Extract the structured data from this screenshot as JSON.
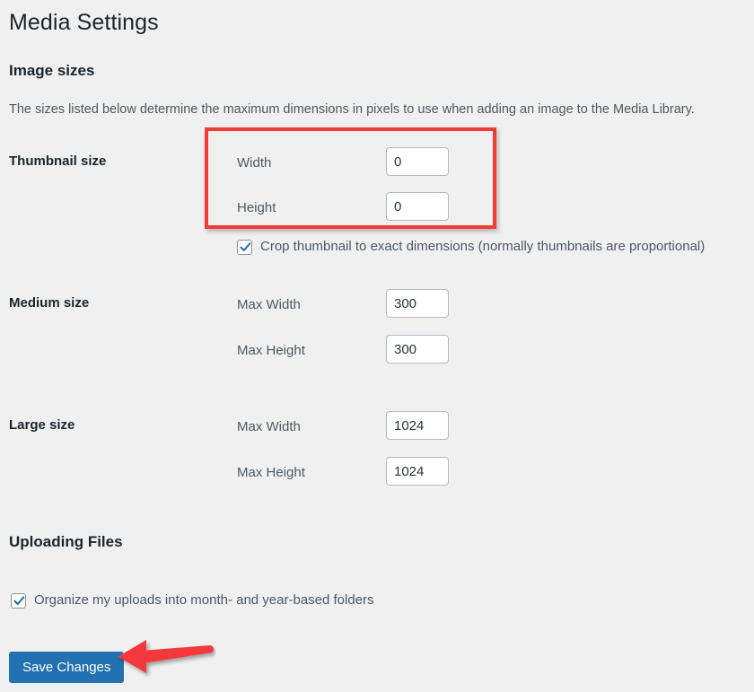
{
  "page": {
    "title": "Media Settings",
    "background_color": "#f0f0f1"
  },
  "image_sizes": {
    "heading": "Image sizes",
    "description": "The sizes listed below determine the maximum dimensions in pixels to use when adding an image to the Media Library.",
    "thumbnail": {
      "row_label": "Thumbnail size",
      "width_label": "Width",
      "width_value": "0",
      "height_label": "Height",
      "height_value": "0",
      "crop_checkbox": {
        "label": "Crop thumbnail to exact dimensions (normally thumbnails are proportional)",
        "checked": true
      }
    },
    "medium": {
      "row_label": "Medium size",
      "width_label": "Max Width",
      "width_value": "300",
      "height_label": "Max Height",
      "height_value": "300"
    },
    "large": {
      "row_label": "Large size",
      "width_label": "Max Width",
      "width_value": "1024",
      "height_label": "Max Height",
      "height_value": "1024"
    }
  },
  "uploading_files": {
    "heading": "Uploading Files",
    "organize_checkbox": {
      "label": "Organize my uploads into month- and year-based folders",
      "checked": true
    }
  },
  "actions": {
    "save_label": "Save Changes",
    "save_color": "#2271b1"
  },
  "annotations": {
    "highlight_color": "#f03c35",
    "arrow_color": "#f5383a",
    "arrow_direction": "left"
  }
}
